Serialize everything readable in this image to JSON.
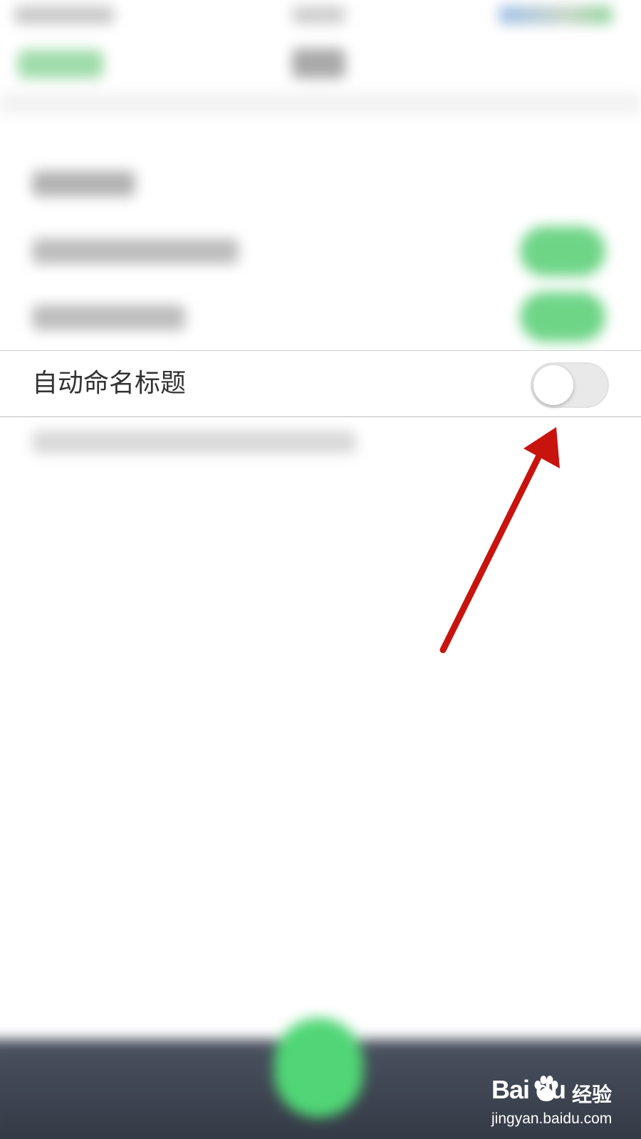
{
  "setting": {
    "label": "自动命名标题",
    "toggle_on": false
  },
  "colors": {
    "toggle_track_off": "#e9e9ea",
    "toggle_on_green": "#6ed587",
    "annotation_arrow": "#c8140f",
    "bottom_bar": "#2f3540"
  },
  "icons": {
    "annotation": "red-arrow-icon",
    "watermark_paw": "baidu-paw-icon"
  },
  "watermark": {
    "brand": "Bai du",
    "cn": "经验",
    "url": "jingyan.baidu.com"
  }
}
